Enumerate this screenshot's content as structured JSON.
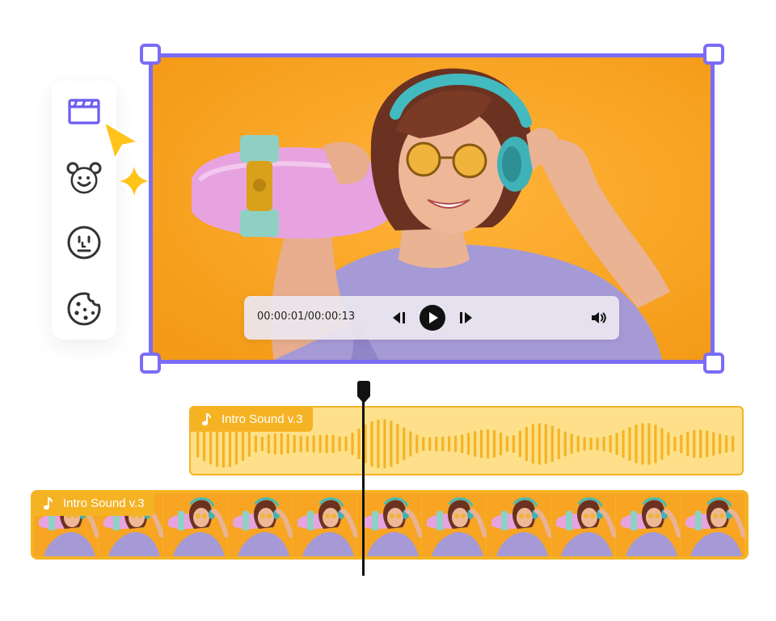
{
  "palette": {
    "tools": [
      {
        "name": "clapperboard-icon"
      },
      {
        "name": "bear-sticker-icon"
      },
      {
        "name": "face-emoji-icon"
      },
      {
        "name": "cookie-icon"
      }
    ]
  },
  "player": {
    "time": "00:00:01/00:00:13",
    "progress": 0.077
  },
  "timeline": {
    "audio_track": {
      "label": "Intro Sound v.3"
    },
    "video_track": {
      "label": "Intro Sound v.3",
      "frame_count": 11
    }
  },
  "colors": {
    "selection": "#7b6cf6",
    "track_accent": "#f5b324",
    "audio_fill": "#fde089",
    "background_orange": "#f7a523"
  }
}
